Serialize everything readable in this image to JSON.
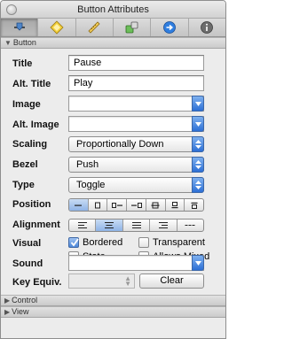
{
  "window": {
    "title": "Button Attributes"
  },
  "toolbar": {
    "tabs": [
      {
        "icon": "slider-attributes-icon",
        "active": true
      },
      {
        "icon": "effects-diamond-icon",
        "active": false
      },
      {
        "icon": "ruler-size-icon",
        "active": false
      },
      {
        "icon": "connections-icon",
        "active": false
      },
      {
        "icon": "bindings-arrow-icon",
        "active": false
      },
      {
        "icon": "info-icon",
        "active": false
      }
    ]
  },
  "sections": {
    "button": "Button",
    "control": "Control",
    "view": "View"
  },
  "fields": {
    "title_label": "Title",
    "title_value": "Pause",
    "alt_title_label": "Alt. Title",
    "alt_title_value": "Play",
    "image_label": "Image",
    "image_value": "",
    "alt_image_label": "Alt. Image",
    "alt_image_value": "",
    "scaling_label": "Scaling",
    "scaling_value": "Proportionally Down",
    "bezel_label": "Bezel",
    "bezel_value": "Push",
    "type_label": "Type",
    "type_value": "Toggle",
    "position_label": "Position",
    "position_selected_index": 0,
    "alignment_label": "Alignment",
    "alignment_selected_index": 1,
    "visual_label": "Visual",
    "sound_label": "Sound",
    "sound_value": "",
    "key_equiv_label": "Key Equiv.",
    "clear_label": "Clear"
  },
  "visual_options": [
    {
      "label": "Bordered",
      "checked": true
    },
    {
      "label": "Transparent",
      "checked": false
    },
    {
      "label": "State",
      "checked": false
    },
    {
      "label": "Allows Mixed",
      "checked": false
    }
  ],
  "colors": {
    "accent": "#2c6fd6",
    "panel": "#ececec"
  }
}
